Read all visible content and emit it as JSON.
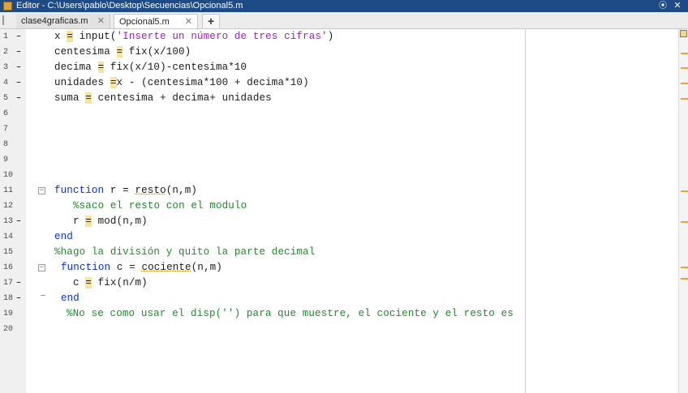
{
  "window": {
    "title": "Editor - C:\\Users\\pablo\\Desktop\\Secuencias\\Opcional5.m",
    "minimize_glyph": "⦿",
    "close_glyph": "✕",
    "icon_name": "matlab-editor-icon"
  },
  "tabs": [
    {
      "label": "clase4graficas.m",
      "close": "✕"
    },
    {
      "label": "Opcional5.m",
      "close": "✕"
    }
  ],
  "add_tab_label": "+",
  "gutter": {
    "numbers": [
      "1",
      "2",
      "3",
      "4",
      "5",
      "6",
      "7",
      "8",
      "9",
      "10",
      "11",
      "12",
      "13",
      "14",
      "15",
      "16",
      "17",
      "18",
      "19",
      "20"
    ],
    "dash": "–"
  },
  "code": {
    "l1_a": "x ",
    "l1_b": "=",
    "l1_c": " input(",
    "l1_d": "'Inserte un número de tres cifras'",
    "l1_e": ")",
    "l2_a": "centesima ",
    "l2_b": "=",
    "l2_c": " fix(x/100)",
    "l3_a": "decima ",
    "l3_b": "=",
    "l3_c": " fix(x/10)-centesima*10",
    "l4_a": "unidades ",
    "l4_b": "=",
    "l4_c": "x - (centesima*100 + decima*10)",
    "l5_a": "suma ",
    "l5_b": "=",
    "l5_c": " centesima + decima+ unidades",
    "l11_kw": "function",
    "l11_a": " r = ",
    "l11_fn": "resto",
    "l11_b": "(n,m)",
    "l12": "%saco el resto con el modulo",
    "l13_a": "r ",
    "l13_b": "=",
    "l13_c": " mod(n,m)",
    "l14": "end",
    "l15": "%hago la división y quito la parte decimal",
    "l16_kw": "function",
    "l16_a": " c = ",
    "l16_fn": "cociente",
    "l16_b": "(n,m)",
    "l17_a": "c ",
    "l17_b": "=",
    "l17_c": " fix(n/m)",
    "l18": "end",
    "l19": "%No se como usar el disp('') para que muestre, el cociente y el resto es"
  },
  "colors": {
    "titlebar": "#1e4a86",
    "keyword": "#0b2fd6",
    "string": "#a021c8",
    "comment": "#1f8a2a",
    "highlight": "#f5e3a1",
    "warning_mark": "#e8a33a"
  }
}
